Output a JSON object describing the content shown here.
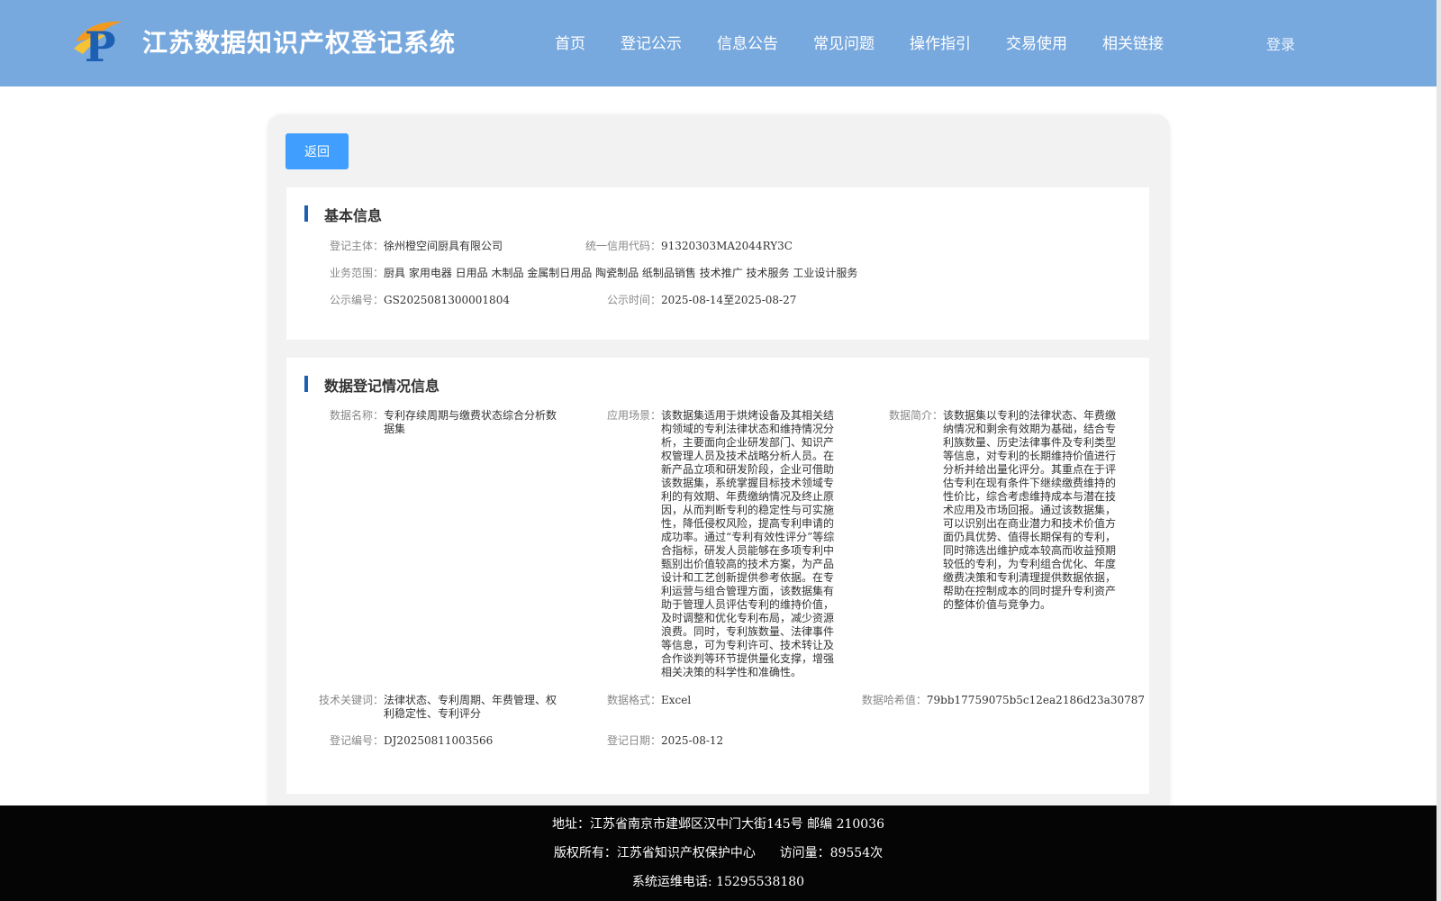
{
  "header": {
    "site_title": "江苏数据知识产权登记系统",
    "logo_letter": "P",
    "nav": [
      "首页",
      "登记公示",
      "信息公告",
      "常见问题",
      "操作指引",
      "交易使用",
      "相关链接"
    ],
    "login": "登录"
  },
  "back_button": "返回",
  "basic_info": {
    "title": "基本信息",
    "subject_label": "登记主体：",
    "subject_value": "徐州橙空间厨具有限公司",
    "credit_code_label": "统一信用代码：",
    "credit_code_value": "91320303MA2044RY3C",
    "scope_label": "业务范围：",
    "scope_value": "厨具 家用电器 日用品 木制品 金属制日用品 陶瓷制品 纸制品销售 技术推广 技术服务 工业设计服务",
    "notice_no_label": "公示编号：",
    "notice_no_value": "GS2025081300001804",
    "notice_time_label": "公示时间：",
    "notice_time_value": "2025-08-14至2025-08-27"
  },
  "registration_info": {
    "title": "数据登记情况信息",
    "data_name_label": "数据名称：",
    "data_name_value": "专利存续周期与缴费状态综合分析数据集",
    "scenario_label": "应用场景：",
    "scenario_value": "该数据集适用于烘烤设备及其相关结构领域的专利法律状态和维持情况分析，主要面向企业研发部门、知识产权管理人员及技术战略分析人员。在新产品立项和研发阶段，企业可借助该数据集，系统掌握目标技术领域专利的有效期、年费缴纳情况及终止原因，从而判断专利的稳定性与可实施性，降低侵权风险，提高专利申请的成功率。通过“专利有效性评分”等综合指标，研发人员能够在多项专利中甄别出价值较高的技术方案，为产品设计和工艺创新提供参考依据。在专利运营与组合管理方面，该数据集有助于管理人员评估专利的维持价值，及时调整和优化专利布局，减少资源浪费。同时，专利族数量、法律事件等信息，可为专利许可、技术转让及合作谈判等环节提供量化支撑，增强相关决策的科学性和准确性。",
    "summary_label": "数据简介：",
    "summary_value": "该数据集以专利的法律状态、年费缴纳情况和剩余有效期为基础，结合专利族数量、历史法律事件及专利类型等信息，对专利的长期维持价值进行分析并给出量化评分。其重点在于评估专利在现有条件下继续缴费维持的性价比，综合考虑维持成本与潜在技术应用及市场回报。通过该数据集，可以识别出在商业潜力和技术价值方面仍具优势、值得长期保有的专利，同时筛选出维护成本较高而收益预期较低的专利，为专利组合优化、年度缴费决策和专利清理提供数据依据，帮助在控制成本的同时提升专利资产的整体价值与竞争力。",
    "keywords_label": "技术关键词：",
    "keywords_value": "法律状态、专利周期、年费管理、权利稳定性、专利评分",
    "format_label": "数据格式：",
    "format_value": "Excel",
    "hash_label": "数据哈希值：",
    "hash_value": "79bb17759075b5c12ea2186d23a30787",
    "reg_no_label": "登记编号：",
    "reg_no_value": "DJ20250811003566",
    "reg_date_label": "登记日期：",
    "reg_date_value": "2025-08-12"
  },
  "footer": {
    "address": "地址：江苏省南京市建邺区汉中门大街145号 邮编 210036",
    "copyright": "版权所有：江苏省知识产权保护中心      访问量：89554次",
    "phone": "系统运维电话: 15295538180"
  },
  "colors": {
    "header_bg": "#78a9de",
    "primary_button": "#409eff",
    "title_accent": "#1f5fae",
    "footer_bg": "#050505"
  },
  "icons": {
    "logo": "p-logo-icon"
  }
}
